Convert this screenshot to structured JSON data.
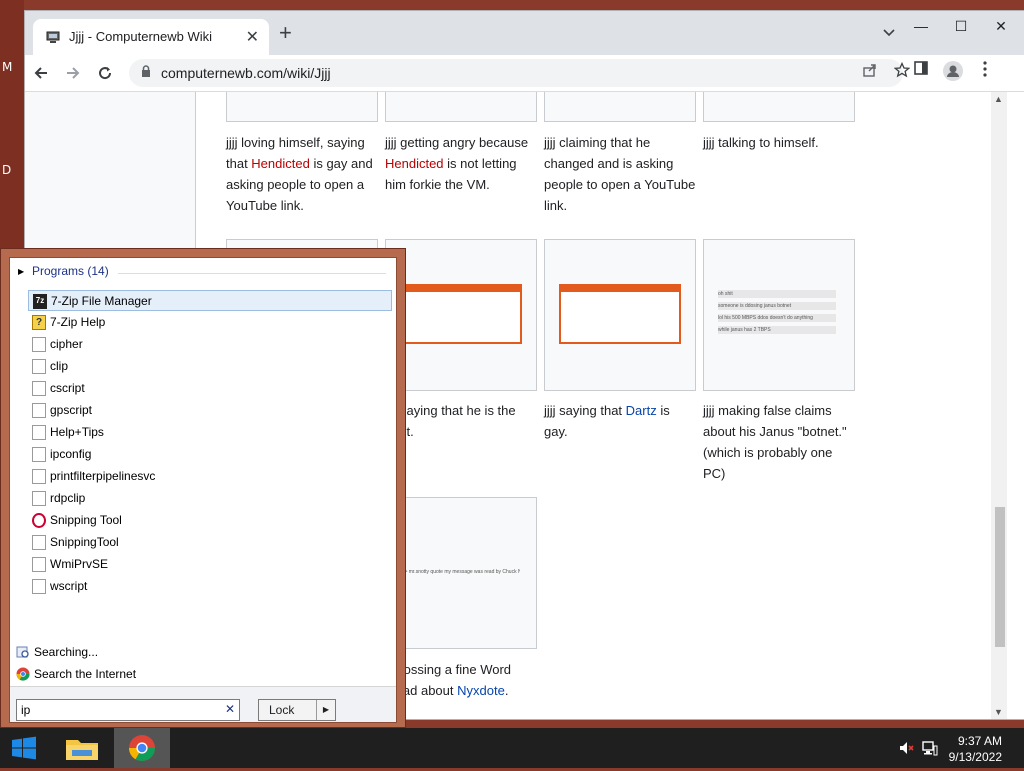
{
  "browser": {
    "tab_title": "Jjjj - Computernewb Wiki",
    "tab_close": "✕",
    "new_tab": "+",
    "url": "computernewb.com/wiki/Jjjj",
    "window_controls": {
      "minimize": "—",
      "maximize": "☐",
      "close": "✕"
    }
  },
  "desktop": {
    "letter_m": "M",
    "letter_d": "D"
  },
  "gallery": [
    {
      "parts": [
        "jjjj loving himself, saying that ",
        "Hendicted",
        " is gay and asking people to open a YouTube link."
      ]
    },
    {
      "parts": [
        "jjjj getting angry because ",
        "Hendicted",
        " is not letting him forkie the VM."
      ]
    },
    {
      "parts": [
        "jjjj claiming that he changed and is asking people to open a YouTube link."
      ]
    },
    {
      "parts": [
        "jjjj talking to himself."
      ]
    },
    {
      "parts": [
        "saying that he is the",
        "st."
      ]
    },
    {
      "parts": [
        "jjjj saying that ",
        "Dartz",
        " is gay."
      ]
    },
    {
      "parts": [
        "jjjj making false claims about his Janus \"botnet.\" (which is probably one PC)"
      ]
    },
    {
      "parts": [
        "tossing a fine Word",
        "lad about ",
        "Nyxdote",
        "."
      ]
    }
  ],
  "chat_lines": [
    "oh shit",
    "someone is ddosing janus botnet",
    "lol his 500 MBPS ddos doesn't do anything",
    "while janus has 2 TBPS"
  ],
  "chat_single": "jjjj> mr.snotty quote my message was read by Chuck Norris",
  "start_menu": {
    "programs_header": "Programs (14)",
    "programs": [
      {
        "label": "7-Zip File Manager",
        "icon": "zip-icon",
        "selected": true
      },
      {
        "label": "7-Zip Help",
        "icon": "help-icon"
      },
      {
        "label": "cipher",
        "icon": "document-icon"
      },
      {
        "label": "clip",
        "icon": "document-icon"
      },
      {
        "label": "cscript",
        "icon": "document-icon"
      },
      {
        "label": "gpscript",
        "icon": "document-icon"
      },
      {
        "label": "Help+Tips",
        "icon": "document-icon"
      },
      {
        "label": "ipconfig",
        "icon": "document-icon"
      },
      {
        "label": "printfilterpipelinesvc",
        "icon": "document-icon"
      },
      {
        "label": "rdpclip",
        "icon": "document-icon"
      },
      {
        "label": "Snipping Tool",
        "icon": "snipping-tool-icon"
      },
      {
        "label": "SnippingTool",
        "icon": "document-icon"
      },
      {
        "label": "WmiPrvSE",
        "icon": "document-icon"
      },
      {
        "label": "wscript",
        "icon": "document-icon"
      }
    ],
    "searching": "Searching...",
    "search_internet": "Search the Internet",
    "search_value": "ip",
    "search_clear": "✕",
    "lock_label": "Lock",
    "lock_arrow": "▶"
  },
  "taskbar": {
    "time": "9:37 AM",
    "date": "9/13/2022"
  },
  "colors": {
    "accent": "#e25a1c",
    "red_link": "#ba0000",
    "blue_link": "#0645ad"
  }
}
